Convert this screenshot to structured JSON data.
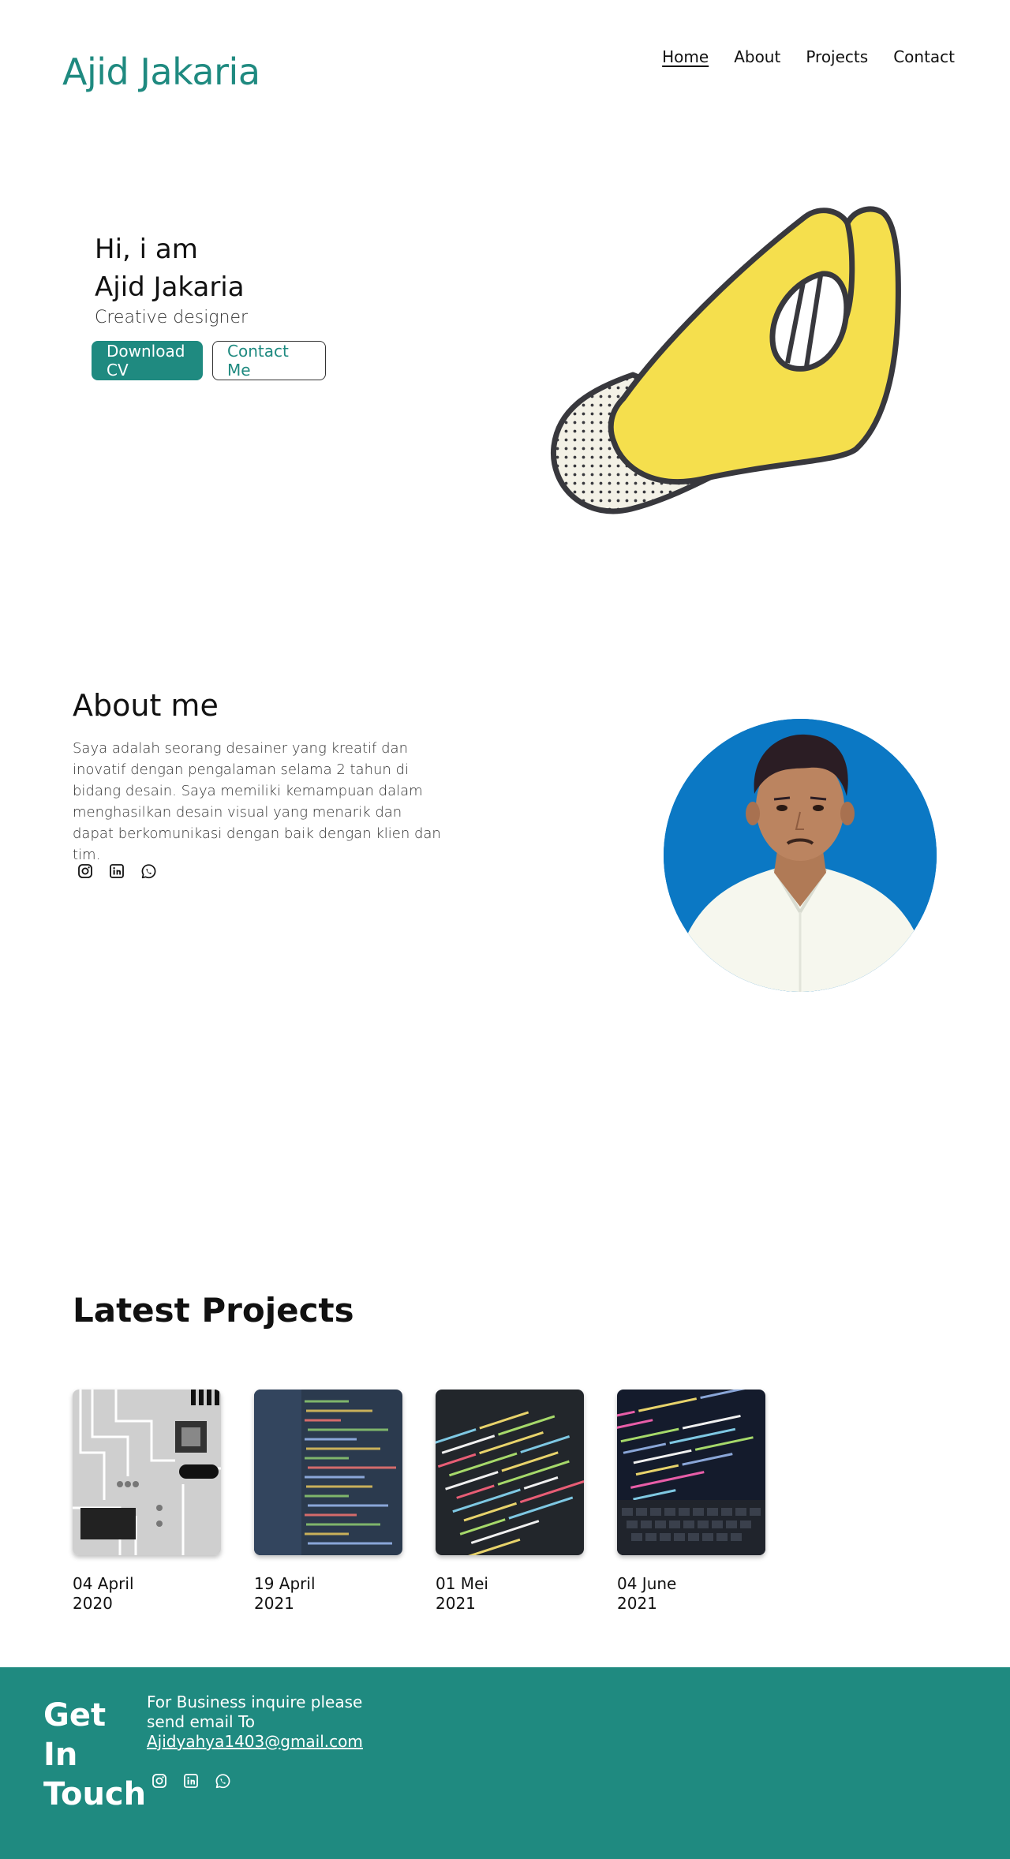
{
  "header": {
    "logo": "Ajid Jakaria",
    "nav": [
      "Home",
      "About",
      "Projects",
      "Contact"
    ]
  },
  "hero": {
    "greeting": "Hi, i am",
    "name": "Ajid Jakaria",
    "role": "Creative designer",
    "download_label": "Download CV",
    "contact_label": "Contact Me",
    "colors": {
      "accent": "#1f8a80",
      "hand": "#f5df4d",
      "outline": "#38383d"
    }
  },
  "about": {
    "title": "About me",
    "text": "Saya adalah seorang desainer yang kreatif dan inovatif dengan pengalaman selama 2 tahun di bidang desain. Saya memiliki kemampuan dalam menghasilkan desain visual yang menarik dan dapat berkomunikasi dengan baik dengan klien dan tim.",
    "socials": [
      "instagram-icon",
      "linkedin-icon",
      "whatsapp-icon"
    ]
  },
  "projects": {
    "title": "Latest Projects",
    "items": [
      {
        "date": "04 April 2020"
      },
      {
        "date": "19 April 2021"
      },
      {
        "date": "01 Mei 2021"
      },
      {
        "date": "04 June 2021"
      }
    ]
  },
  "footer": {
    "title": "Get In Touch",
    "text": "For Business inquire please send email To",
    "email": "Ajidyahya1403@gmail.com",
    "background": "#1f8a80"
  }
}
